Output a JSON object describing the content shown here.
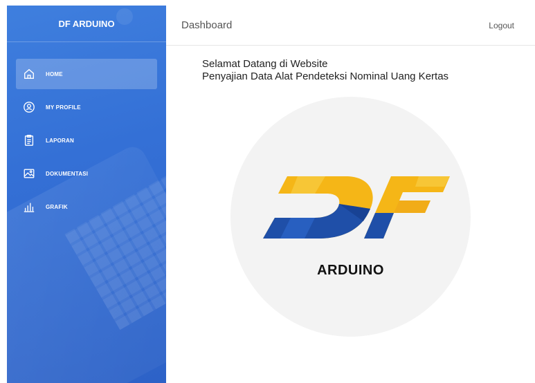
{
  "brand": {
    "name": "DF ARDUINO"
  },
  "sidebar": {
    "items": [
      {
        "label": "HOME",
        "icon": "home-icon",
        "active": true
      },
      {
        "label": "MY PROFILE",
        "icon": "user-circle-icon",
        "active": false
      },
      {
        "label": "LAPORAN",
        "icon": "clipboard-icon",
        "active": false
      },
      {
        "label": "DOKUMENTASI",
        "icon": "image-icon",
        "active": false
      },
      {
        "label": "GRAFIK",
        "icon": "bar-chart-icon",
        "active": false
      }
    ]
  },
  "header": {
    "title": "Dashboard",
    "logout_label": "Logout"
  },
  "main": {
    "welcome_line1": "Selamat Datang di Website",
    "welcome_line2": "Penyajian Data Alat Pendeteksi Nominal Uang Kertas",
    "logo_text": "ARDUINO"
  },
  "colors": {
    "sidebar": "#3470d6",
    "logo_yellow": "#f5b617",
    "logo_blue": "#1f4fa8"
  }
}
